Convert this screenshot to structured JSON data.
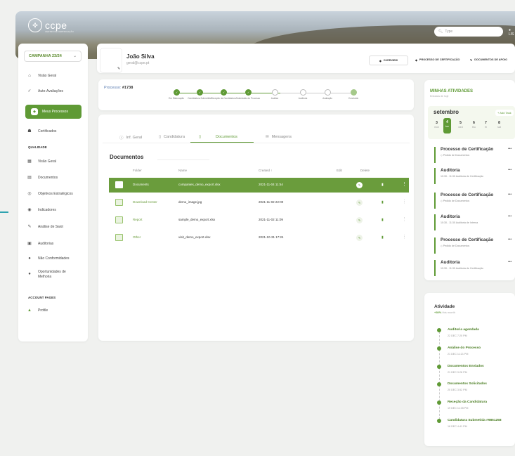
{
  "brand": {
    "logo_text": "ccpe",
    "logo_sub": "CENTRO DE CERTIFICAÇÃO"
  },
  "header": {
    "search_placeholder": "Type",
    "user_label": "LIS"
  },
  "sidebar": {
    "campaign": "CAMPANHA 23/24",
    "main": [
      {
        "label": "Visão Geral",
        "icon": "home-icon"
      },
      {
        "label": "Auto-Avaliações",
        "icon": "checklist-icon"
      }
    ],
    "active": {
      "label": "Meus Processos",
      "icon": "process-icon"
    },
    "main2": [
      {
        "label": "Certificados",
        "icon": "certificate-icon"
      }
    ],
    "section_quality": "QUALIDADE",
    "quality": [
      {
        "label": "Visão Geral",
        "icon": "grid-icon"
      },
      {
        "label": "Documentos",
        "icon": "document-icon"
      },
      {
        "label": "Objetivos Estratégicos",
        "icon": "target-icon"
      },
      {
        "label": "Indicadores",
        "icon": "indicator-icon"
      },
      {
        "label": "Análise de Swot",
        "icon": "pen-icon"
      },
      {
        "label": "Auditorias",
        "icon": "audit-icon"
      },
      {
        "label": "Não Conformidades",
        "icon": "warning-icon"
      },
      {
        "label": "Oportunidades de Melhoria",
        "icon": "lightbulb-icon"
      }
    ],
    "section_account": "ACCOUNT PAGES",
    "account": [
      {
        "label": "Profile",
        "icon": "user-icon"
      }
    ]
  },
  "profile": {
    "name": "João Silva",
    "email": "geral@ccpe.pt",
    "tabs": [
      "OVERVIEW",
      "PROCESSO DE CERTIFICAÇÃO",
      "DOCUMENTOS DE APOIO"
    ]
  },
  "process": {
    "label": "Processo:",
    "number": "#1738",
    "steps": [
      {
        "label": "Em Elaboração",
        "state": "done"
      },
      {
        "label": "Candidatura Submetida",
        "state": "done"
      },
      {
        "label": "Receção da Candidatura",
        "state": "done"
      },
      {
        "label": "Submissão do Processo",
        "state": "done"
      },
      {
        "label": "Análise",
        "state": "todo"
      },
      {
        "label": "Auditoria",
        "state": "todo"
      },
      {
        "label": "Avaliação",
        "state": "todo"
      },
      {
        "label": "Concluído",
        "state": "light"
      }
    ]
  },
  "docs": {
    "tabs": [
      {
        "label": "Inf. Geral",
        "icon": "info-icon"
      },
      {
        "label": "Candidatura",
        "icon": "file-icon"
      },
      {
        "label": "",
        "icon": "file-icon"
      },
      {
        "label": "Documentos",
        "icon": ""
      },
      {
        "label": "Mensagens",
        "icon": "mail-icon"
      }
    ],
    "title": "Documentos",
    "columns": [
      "Folder",
      "Name",
      "Created",
      "Edit",
      "Delete"
    ],
    "sort_arrow": "↑",
    "rows": [
      {
        "folder": "Documents",
        "name": "companies_demo_export.xlsx",
        "created": "2021-11-04 11:54",
        "active": true
      },
      {
        "folder": "Download Center",
        "name": "demo_image.jpg",
        "created": "2021-11-02 22:00",
        "active": false
      },
      {
        "folder": "Report",
        "name": "sample_demo_export.xlsx",
        "created": "2021-11-02 11:09",
        "active": false
      },
      {
        "folder": "Other",
        "name": "visit_demo_export.xlsx",
        "created": "2021-10-31 17:24",
        "active": false
      }
    ]
  },
  "activities": {
    "title": "MINHAS ATIVIDADES",
    "subtitle": "Entradas de hoje",
    "month": "setembro",
    "add_task": "+ Add Task",
    "days": [
      {
        "num": "3",
        "name": "mon"
      },
      {
        "num": "4",
        "name": "tue",
        "selected": true
      },
      {
        "num": "5",
        "name": "wed"
      },
      {
        "num": "6",
        "name": "thu"
      },
      {
        "num": "7",
        "name": "fri"
      },
      {
        "num": "8",
        "name": "sat"
      }
    ],
    "items": [
      {
        "title": "Processo de Certificação",
        "sub": "Pedido de Documentos"
      },
      {
        "title": "Auditoria",
        "sub": "10:30 - 11:30 Auditoria de Certificação"
      },
      {
        "title": "Processo de Certificação",
        "sub": "Pedido de Documentos"
      },
      {
        "title": "Auditoria",
        "sub": "10:30 - 11:30 Auditoria de Interna"
      },
      {
        "title": "Processo de Certificação",
        "sub": "Pedido de Documentos"
      },
      {
        "title": "Auditoria",
        "sub": "10:30 - 11:30 Auditoria de Certificação"
      }
    ]
  },
  "timeline": {
    "title": "Atividade",
    "growth": "+30%",
    "period": "this month",
    "events": [
      {
        "title": "Auditoria agendada",
        "date": "22 DEC 7:20 PM"
      },
      {
        "title": "Análise do Processo",
        "date": "21 DEC 11:21 PM"
      },
      {
        "title": "Documentos Enviados",
        "date": "21 DEC 9:28 PM"
      },
      {
        "title": "Documentos Solicitados",
        "date": "20 DEC 3:52 PM"
      },
      {
        "title": "Receção da Candidatura",
        "date": "19 DEC 11:35 PM"
      },
      {
        "title": "Candidatura Submetida #9851258",
        "date": "18 DEC 4:41 PM"
      }
    ]
  }
}
